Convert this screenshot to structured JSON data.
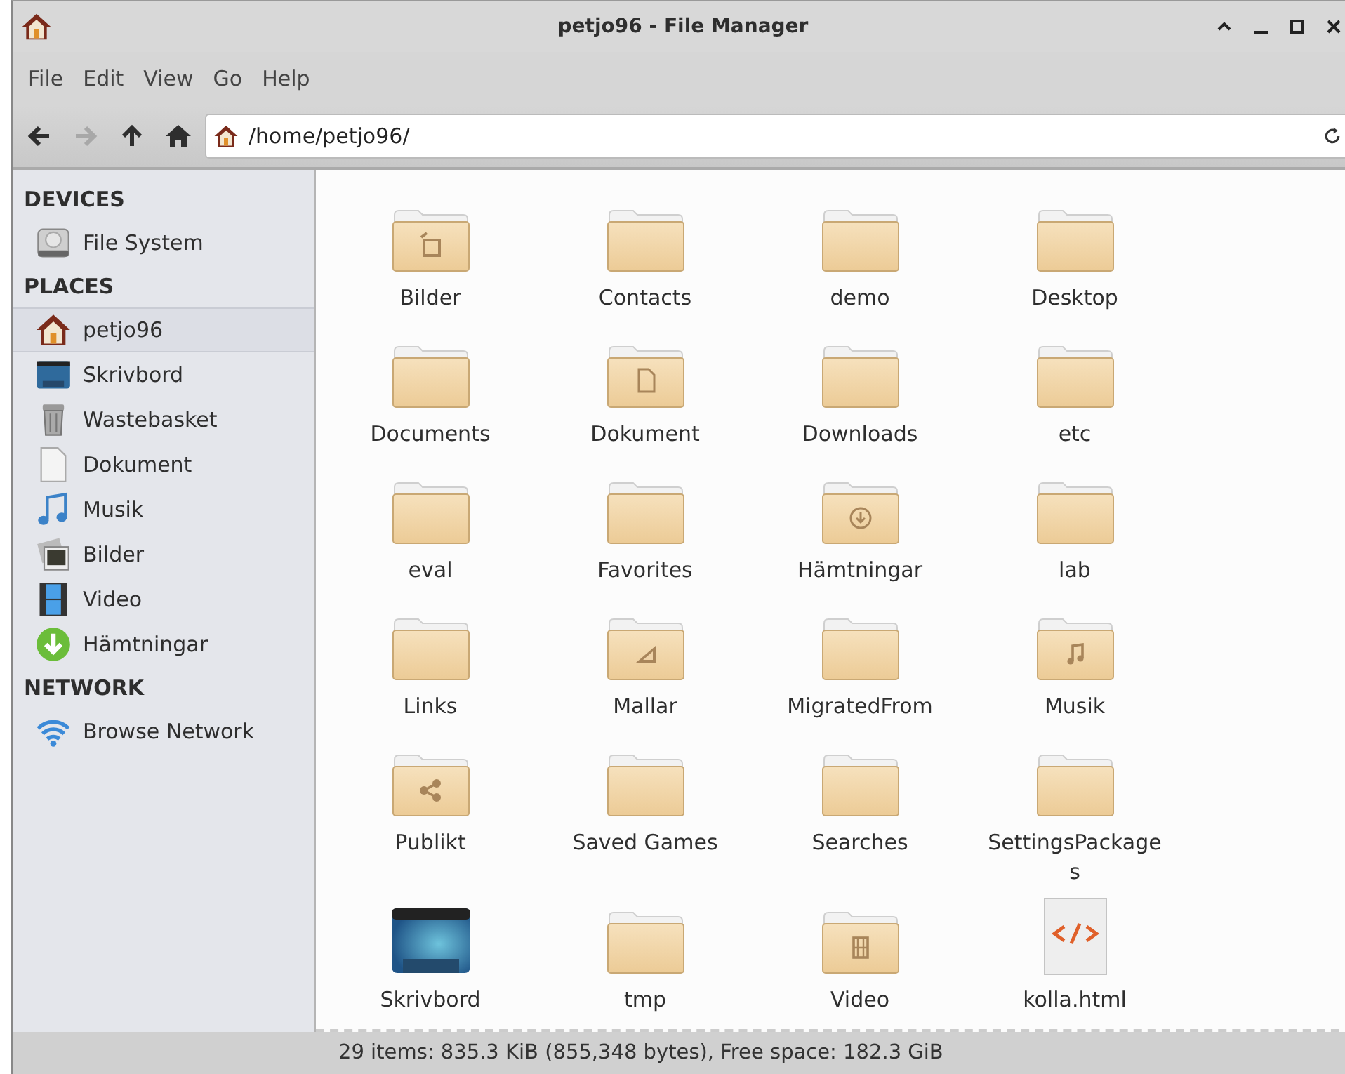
{
  "window": {
    "title": "petjo96 - File Manager"
  },
  "menu": [
    "File",
    "Edit",
    "View",
    "Go",
    "Help"
  ],
  "location": {
    "value": "/home/petjo96/"
  },
  "sidebar": {
    "sections": [
      {
        "heading": "DEVICES",
        "items": [
          {
            "label": "File System",
            "kind": "drive",
            "selected": false
          }
        ]
      },
      {
        "heading": "PLACES",
        "items": [
          {
            "label": "petjo96",
            "kind": "home",
            "selected": true
          },
          {
            "label": "Skrivbord",
            "kind": "desktop",
            "selected": false
          },
          {
            "label": "Wastebasket",
            "kind": "trash",
            "selected": false
          },
          {
            "label": "Dokument",
            "kind": "document",
            "selected": false
          },
          {
            "label": "Musik",
            "kind": "music",
            "selected": false
          },
          {
            "label": "Bilder",
            "kind": "pictures",
            "selected": false
          },
          {
            "label": "Video",
            "kind": "video",
            "selected": false
          },
          {
            "label": "Hämtningar",
            "kind": "download",
            "selected": false
          }
        ]
      },
      {
        "heading": "NETWORK",
        "items": [
          {
            "label": "Browse Network",
            "kind": "network",
            "selected": false
          }
        ]
      }
    ]
  },
  "files": [
    {
      "name": "Bilder",
      "kind": "pictures"
    },
    {
      "name": "Contacts",
      "kind": "folder"
    },
    {
      "name": "demo",
      "kind": "folder"
    },
    {
      "name": "Desktop",
      "kind": "folder"
    },
    {
      "name": "Documents",
      "kind": "folder"
    },
    {
      "name": "Dokument",
      "kind": "documents"
    },
    {
      "name": "Downloads",
      "kind": "folder"
    },
    {
      "name": "etc",
      "kind": "folder"
    },
    {
      "name": "eval",
      "kind": "folder"
    },
    {
      "name": "Favorites",
      "kind": "folder"
    },
    {
      "name": "Hämtningar",
      "kind": "downloads"
    },
    {
      "name": "lab",
      "kind": "folder"
    },
    {
      "name": "Links",
      "kind": "folder"
    },
    {
      "name": "Mallar",
      "kind": "templates"
    },
    {
      "name": "MigratedFrom",
      "kind": "folder"
    },
    {
      "name": "Musik",
      "kind": "music"
    },
    {
      "name": "Publikt",
      "kind": "public"
    },
    {
      "name": "Saved Games",
      "kind": "folder"
    },
    {
      "name": "Searches",
      "kind": "folder"
    },
    {
      "name": "SettingsPackages",
      "kind": "folder"
    },
    {
      "name": "Skrivbord",
      "kind": "desktop"
    },
    {
      "name": "tmp",
      "kind": "folder"
    },
    {
      "name": "Video",
      "kind": "videos"
    },
    {
      "name": "kolla.html",
      "kind": "html"
    }
  ],
  "status_bar": "29 items: 835.3 KiB (855,348 bytes), Free space: 182.3 GiB"
}
